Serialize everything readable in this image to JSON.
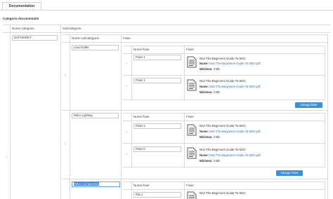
{
  "tabs": {
    "documentation": "Documentation"
  },
  "section_title": "Categorie documentatie",
  "columns": {
    "nume_categorie": "Nume categorie",
    "subcategorie": "Subcategorie",
    "nume_subcategorie": "Nume subcategorie",
    "fisier": "Fisier",
    "nume_fisier": "Nume fisier",
    "fisier2": "Fisier"
  },
  "category": {
    "name": "DATASHEET"
  },
  "subcategories": [
    {
      "name": "Leuci bulbs",
      "files": [
        {
          "name": "Fisier 1",
          "title": "Moz-The-Beginners-Guide-To-SEO",
          "nume_label": "Nume:",
          "nume_value": "Moz-The-Beginners-Guide-To-SEO.pdf",
          "size_label": "Mărimea:",
          "size_value": "3 Mb"
        },
        {
          "name": "Fisier 2",
          "title": "Moz-The-Beginners-Guide-To-SEO",
          "nume_label": "Nume:",
          "nume_value": "Moz-The-Beginners-Guide-To-SEO.pdf",
          "size_label": "Mărimea:",
          "size_value": "3 Mb"
        }
      ],
      "add_button": "Adauga fisier"
    },
    {
      "name": "Relco Lighting",
      "files": [
        {
          "name": "Fisier a",
          "title": "Moz-The-Beginners-Guide-To-SEO",
          "nume_label": "Nume:",
          "nume_value": "Moz-The-Beginners-Guide-To-SEO.pdf",
          "size_label": "Mărimea:",
          "size_value": "3 Mb"
        },
        {
          "name": "Fisier b",
          "title": "Moz-The-Beginners-Guide-To-SEO",
          "nume_label": "Nume:",
          "nume_value": "Moz-The-Beginners-Guide-To-SEO.pdf",
          "size_label": "Mărimea:",
          "size_value": "3 Mb"
        }
      ],
      "add_button": "Adauga Fisier"
    },
    {
      "name": "Relco Components",
      "files": [
        {
          "name": "Fila 1",
          "title": "Moz-The-Beginners-Guide-To-SEO"
        }
      ]
    }
  ],
  "icons": {
    "arrow": "chevron-right-icon",
    "file": "document-icon"
  },
  "colors": {
    "accent": "#3d8fd6",
    "link": "#2f6fb2",
    "selection": "#3b7fd0"
  }
}
